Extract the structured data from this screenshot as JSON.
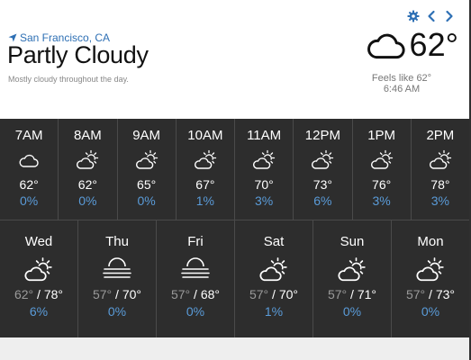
{
  "header": {
    "location": "San Francisco, CA",
    "condition": "Partly Cloudy",
    "description": "Mostly cloudy throughout the day.",
    "current_temp": "62°",
    "feels_like": "Feels like 62°",
    "time": "6:46 AM"
  },
  "controls": {
    "settings_icon": "gear-icon",
    "prev_icon": "chevron-left-icon",
    "next_icon": "chevron-right-icon"
  },
  "colors": {
    "accent": "#2d6fb4",
    "precip": "#5a9bd8",
    "panel": "#2d2d2d"
  },
  "hourly": [
    {
      "label": "7AM",
      "icon": "partly-cloudy-night-icon",
      "temp": "62°",
      "precip": "0%"
    },
    {
      "label": "8AM",
      "icon": "partly-cloudy-icon",
      "temp": "62°",
      "precip": "0%"
    },
    {
      "label": "9AM",
      "icon": "partly-cloudy-icon",
      "temp": "65°",
      "precip": "0%"
    },
    {
      "label": "10AM",
      "icon": "partly-cloudy-icon",
      "temp": "67°",
      "precip": "1%"
    },
    {
      "label": "11AM",
      "icon": "partly-cloudy-icon",
      "temp": "70°",
      "precip": "3%"
    },
    {
      "label": "12PM",
      "icon": "partly-cloudy-icon",
      "temp": "73°",
      "precip": "6%"
    },
    {
      "label": "1PM",
      "icon": "partly-cloudy-icon",
      "temp": "76°",
      "precip": "3%"
    },
    {
      "label": "2PM",
      "icon": "partly-cloudy-icon",
      "temp": "78°",
      "precip": "3%"
    }
  ],
  "daily": [
    {
      "label": "Wed",
      "icon": "partly-cloudy-icon",
      "low": "62°",
      "sep": " / ",
      "high": "78°",
      "precip": "6%"
    },
    {
      "label": "Thu",
      "icon": "fog-icon",
      "low": "57°",
      "sep": " / ",
      "high": "70°",
      "precip": "0%"
    },
    {
      "label": "Fri",
      "icon": "fog-icon",
      "low": "57°",
      "sep": " / ",
      "high": "68°",
      "precip": "0%"
    },
    {
      "label": "Sat",
      "icon": "partly-cloudy-icon",
      "low": "57°",
      "sep": " / ",
      "high": "70°",
      "precip": "1%"
    },
    {
      "label": "Sun",
      "icon": "partly-cloudy-icon",
      "low": "57°",
      "sep": " / ",
      "high": "71°",
      "precip": "0%"
    },
    {
      "label": "Mon",
      "icon": "partly-cloudy-icon",
      "low": "57°",
      "sep": " / ",
      "high": "73°",
      "precip": "0%"
    }
  ]
}
